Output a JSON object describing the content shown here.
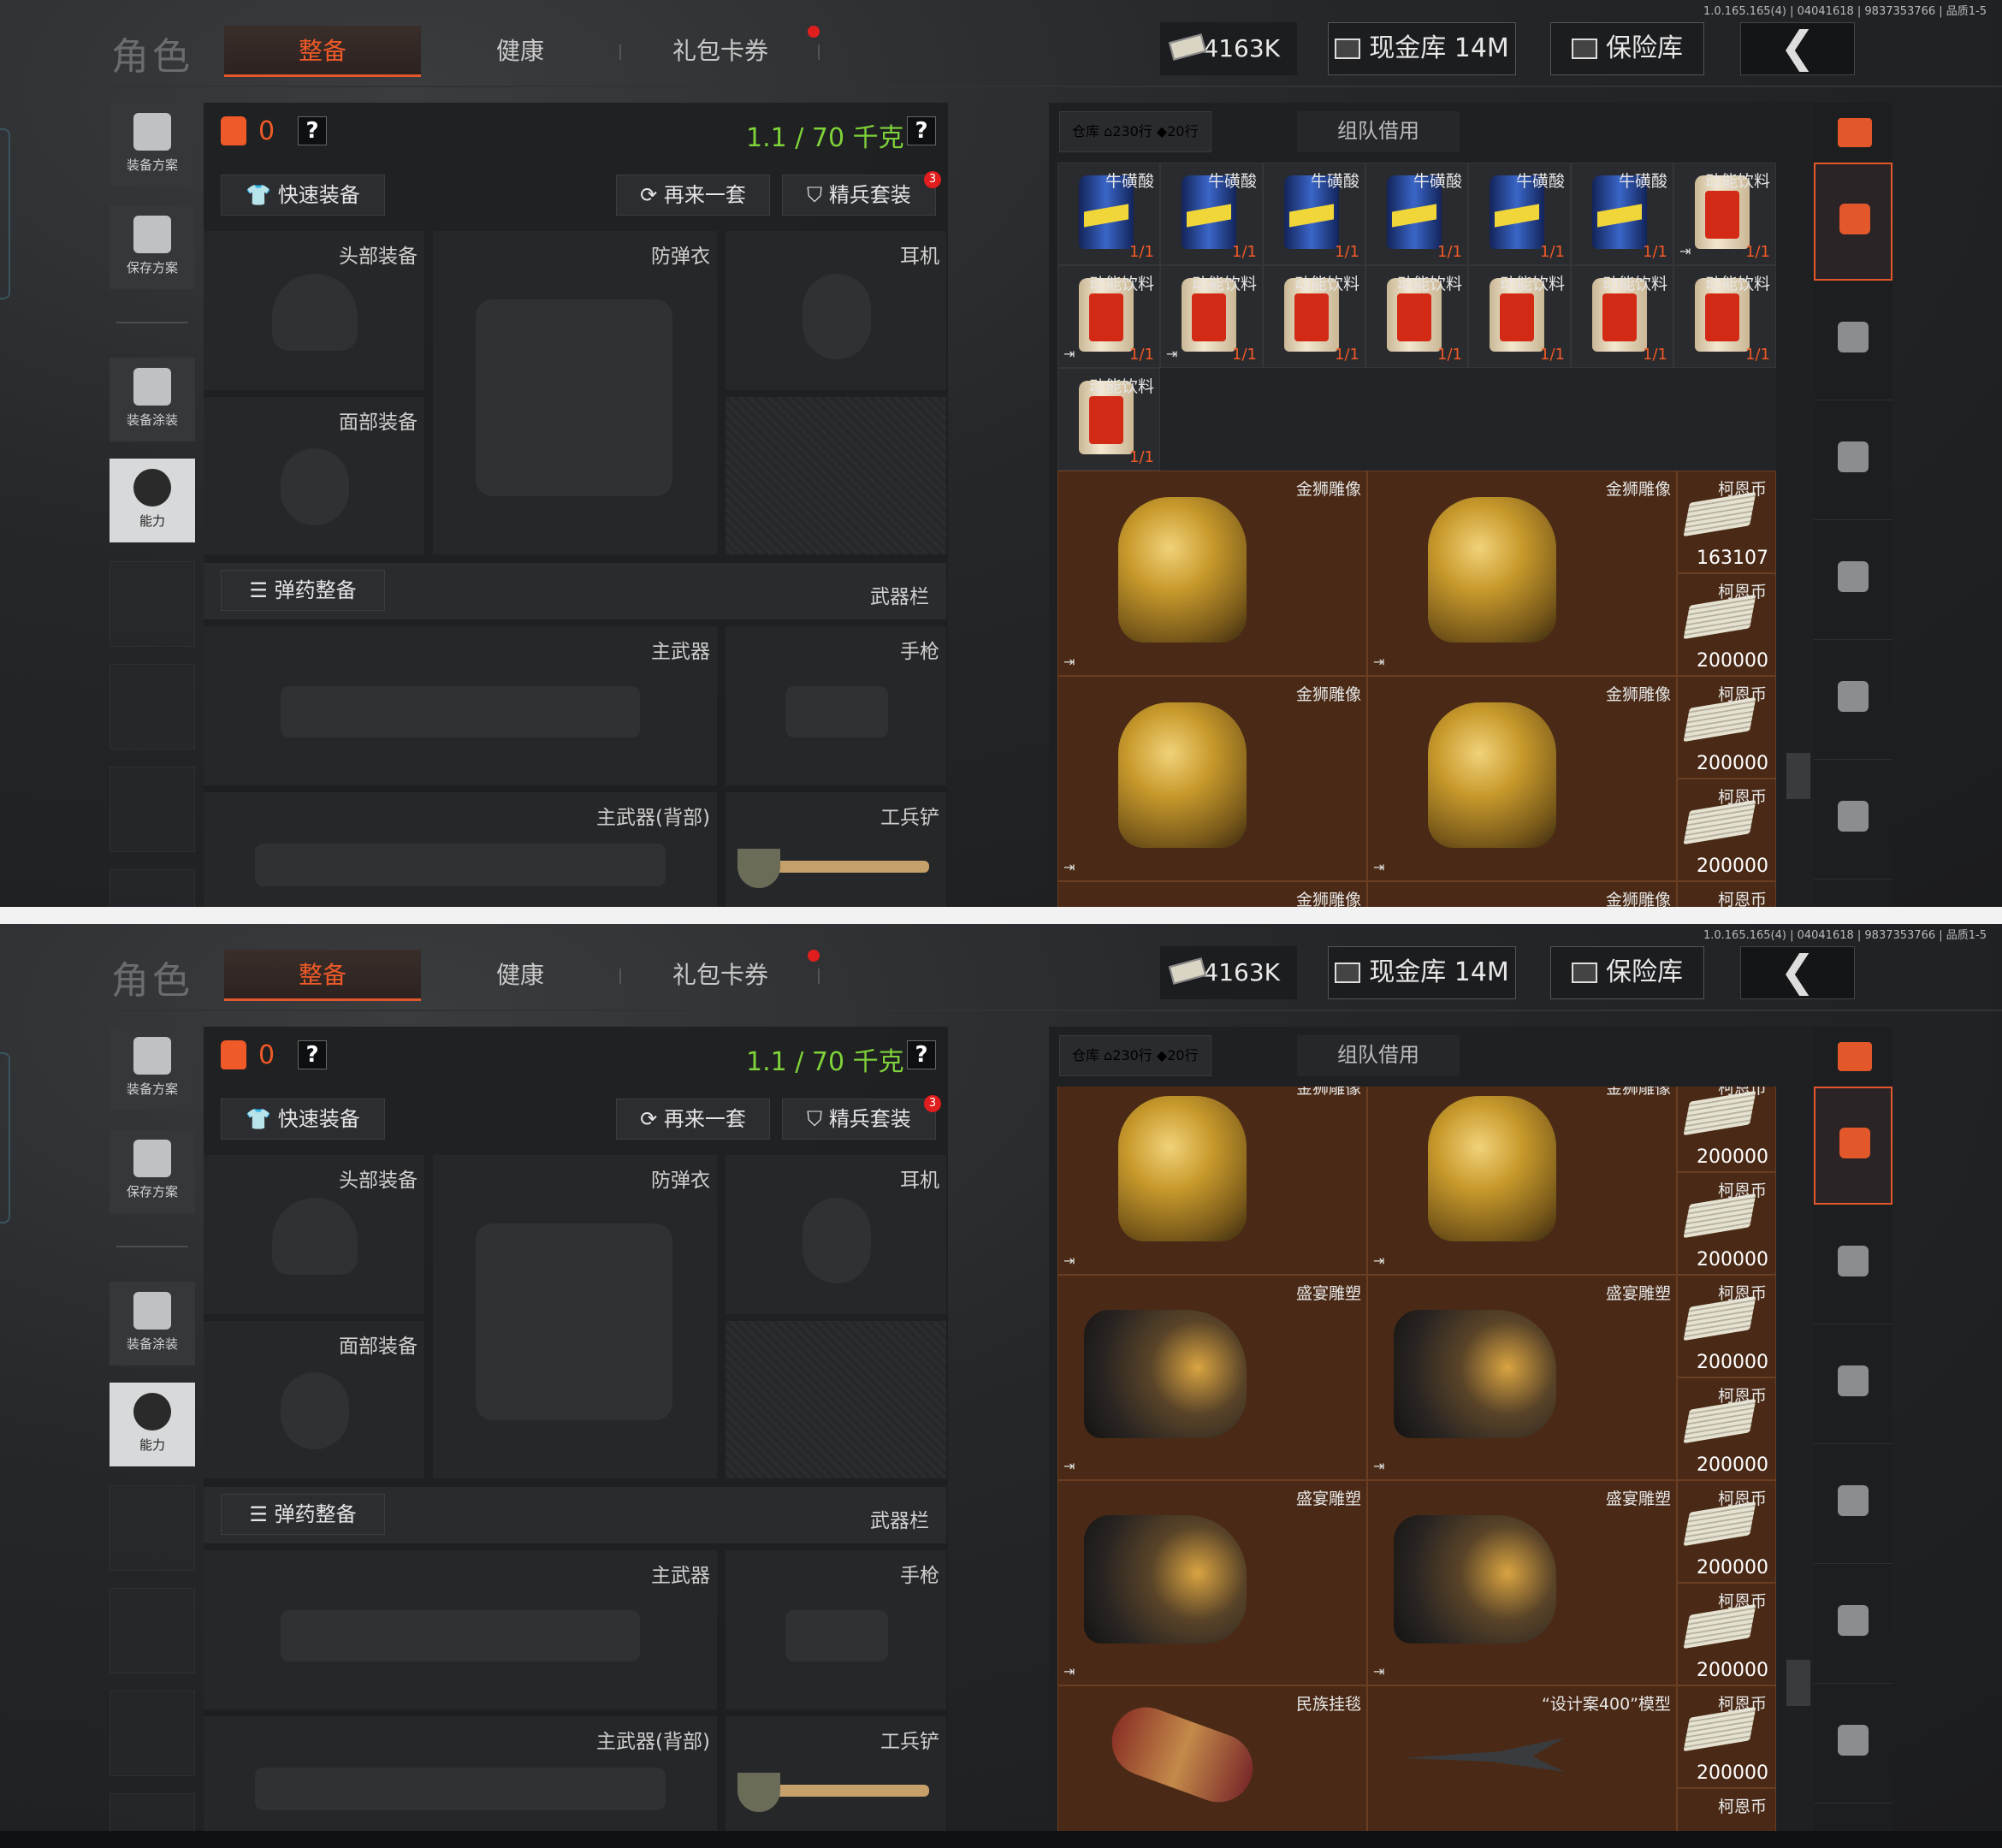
{
  "version": "1.0.165.165(4) | 04041618 | 9837353766 | 品质1-5",
  "header": {
    "title": "角色",
    "tabs": [
      "整备",
      "健康",
      "礼包卡券"
    ],
    "money": "4163K",
    "cash_vault": "现金库 14M",
    "safe": "保险库",
    "back_icon": "chevron-left-icon"
  },
  "sidebar": {
    "items": [
      {
        "label": "装备方案",
        "icon": "vest-plan-icon"
      },
      {
        "label": "保存方案",
        "icon": "download-icon"
      },
      {
        "label": "装备涂装",
        "icon": "helmet-paint-icon"
      },
      {
        "label": "能力",
        "icon": "lightning-icon"
      }
    ]
  },
  "loadout": {
    "armor_count": "0",
    "weight": "1.1 / 70 千克",
    "quick_equip": "快速装备",
    "again": "再来一套",
    "elite_set": "精兵套装",
    "elite_badge": "3",
    "slots": {
      "head": "头部装备",
      "armor": "防弹衣",
      "headphone": "耳机",
      "face": "面部装备",
      "ammo": "弹药整备",
      "weapon_bar": "武器栏",
      "main_weapon": "主武器",
      "pistol": "手枪",
      "main_back": "主武器(背部)",
      "shovel": "工兵铲"
    }
  },
  "inventory": {
    "warehouse": "仓库",
    "rows_home": "230行",
    "rows_other": "20行",
    "team_borrow": "组队借用",
    "item_names": {
      "acid": "牛磺酸",
      "energy": "动能饮料",
      "lion": "金狮雕像",
      "coin": "柯恩币",
      "bust": "盛宴雕塑",
      "rug": "民族挂毯",
      "model": "“设计案400”模型"
    },
    "stack": "1/1",
    "coin_first": "163107",
    "coin_amount": "200000"
  }
}
